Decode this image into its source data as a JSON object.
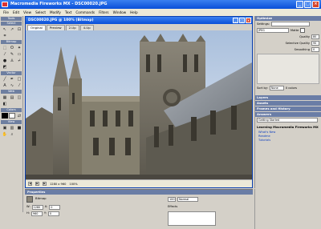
{
  "window": {
    "title": "Macromedia Fireworks MX - DSC00020.JPG",
    "min": "_",
    "max": "□",
    "close": "×"
  },
  "menu": [
    "File",
    "Edit",
    "View",
    "Select",
    "Modify",
    "Text",
    "Commands",
    "Filters",
    "Window",
    "Help"
  ],
  "tools": {
    "header": "Tools",
    "sections": [
      "Select",
      "Bitmap",
      "Vector",
      "Web",
      "Colors",
      "View"
    ]
  },
  "document": {
    "title": "DSC00020.JPG @ 100% (Bitmap)",
    "tabs": [
      "Original",
      "Preview",
      "2-Up",
      "4-Up"
    ],
    "status": {
      "size": "1280 x 960",
      "zoom": "100%"
    }
  },
  "panels": {
    "optimize": {
      "header": "Optimize",
      "settings_label": "Settings:",
      "format": "JPEG",
      "matte_label": "Matte",
      "quality_label": "Quality",
      "quality": "80",
      "selective_label": "Selective Quality",
      "selective": "90",
      "smoothing_label": "Smoothing",
      "smoothing": "0",
      "sortby_label": "Sort by:",
      "sortby": "None",
      "colors_label": "0 colors"
    },
    "collapsed": [
      "Layers",
      "Assets",
      "Frames and History"
    ],
    "answers": {
      "header": "Answers",
      "dropdown": "Getting Started",
      "heading": "Learning Macromedia Fireworks MX",
      "links": [
        "What's New",
        "Readme",
        "Tutorials"
      ]
    }
  },
  "properties": {
    "header": "Properties",
    "kind": "Bitmap",
    "w": "1280",
    "h": "960",
    "x": "0",
    "y": "0",
    "blend": "Normal",
    "opacity": "100",
    "effects_label": "Effects"
  }
}
